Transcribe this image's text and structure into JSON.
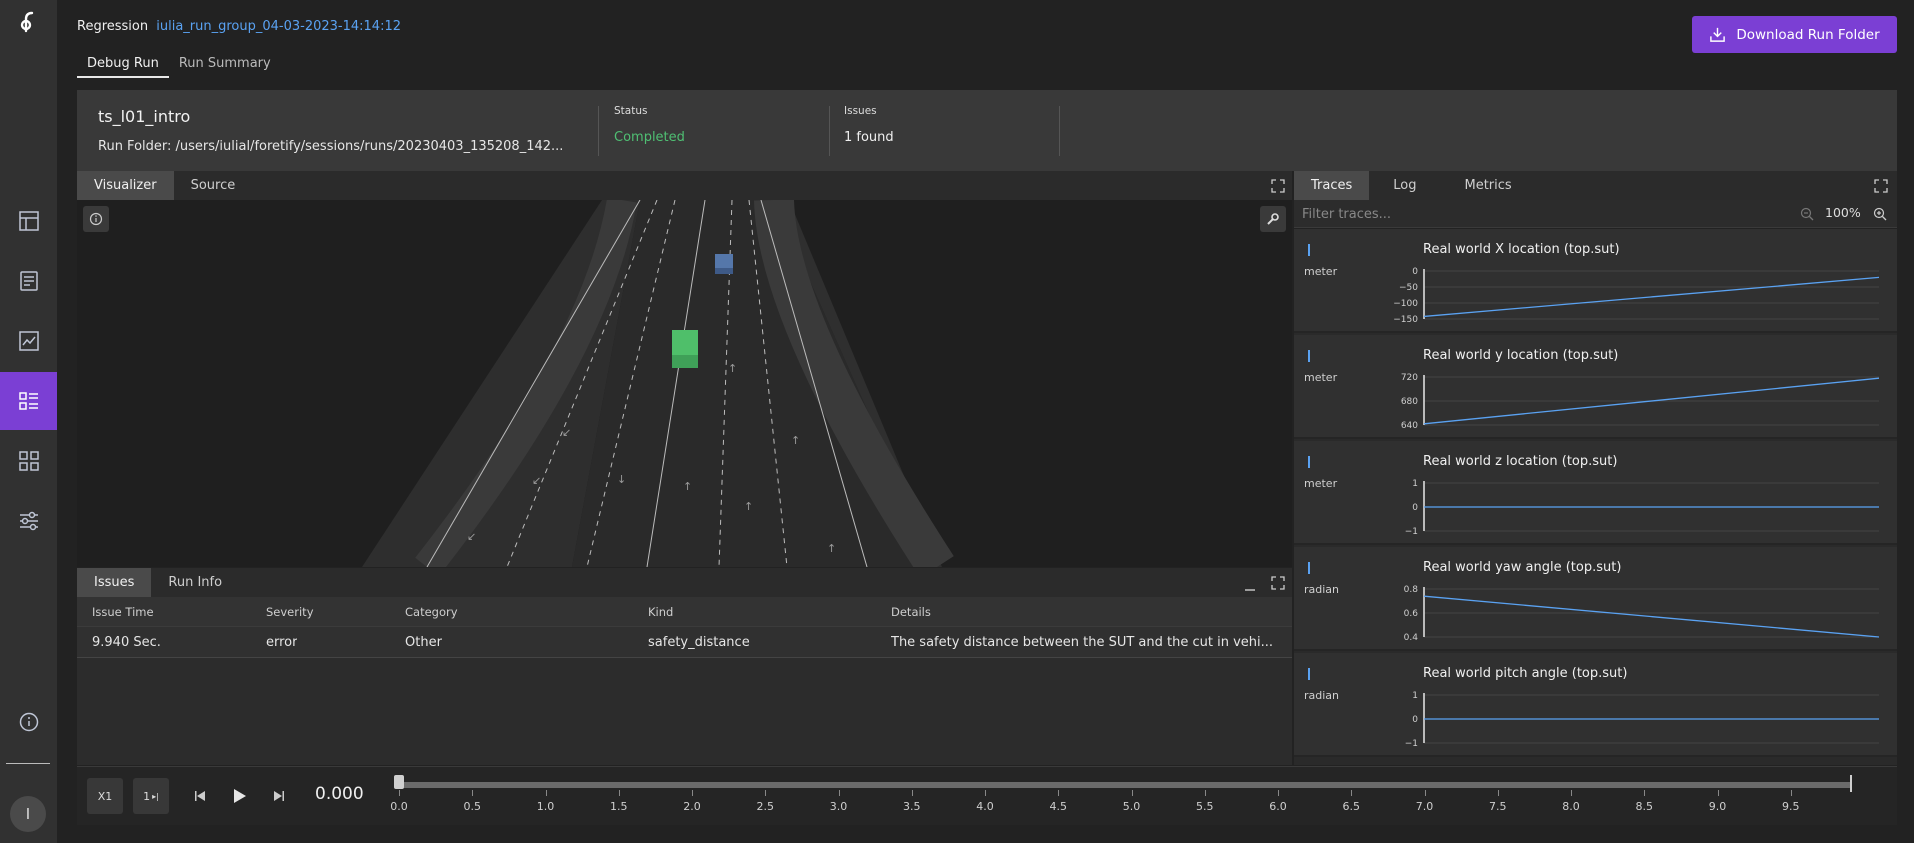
{
  "header": {
    "label": "Regression",
    "run_group": "iulia_run_group_04-03-2023-14:14:12",
    "download_label": "Download Run Folder"
  },
  "top_tabs": [
    {
      "label": "Debug Run",
      "active": true
    },
    {
      "label": "Run Summary",
      "active": false
    }
  ],
  "run": {
    "name": "ts_l01_intro",
    "folder": "Run Folder: /users/iulial/foretify/sessions/runs/20230403_135208_142...",
    "status_label": "Status",
    "status_value": "Completed",
    "issues_label": "Issues",
    "issues_value": "1 found"
  },
  "visualizer": {
    "tabs": [
      {
        "label": "Visualizer",
        "active": true
      },
      {
        "label": "Source",
        "active": false
      }
    ]
  },
  "issues_panel": {
    "tabs": [
      {
        "label": "Issues",
        "active": true
      },
      {
        "label": "Run Info",
        "active": false
      }
    ],
    "columns": [
      "Issue Time",
      "Severity",
      "Category",
      "Kind",
      "Details"
    ],
    "rows": [
      [
        "9.940 Sec.",
        "error",
        "Other",
        "safety_distance",
        "The safety distance between the SUT and the cut in vehi..."
      ]
    ]
  },
  "traces_panel": {
    "tabs": [
      {
        "label": "Traces",
        "active": true
      },
      {
        "label": "Log",
        "active": false
      },
      {
        "label": "Metrics",
        "active": false
      }
    ],
    "filter_placeholder": "Filter traces...",
    "zoom": "100%",
    "traces": [
      {
        "title": "Real world X location (top.sut)",
        "unit": "meter",
        "ticks": [
          "0",
          "−50",
          "−100",
          "−150"
        ],
        "ymin": -150,
        "ymax": 0,
        "start": -142,
        "end": -20
      },
      {
        "title": "Real world y location (top.sut)",
        "unit": "meter",
        "ticks": [
          "720",
          "680",
          "640"
        ],
        "ymin": 640,
        "ymax": 720,
        "start": 642,
        "end": 718
      },
      {
        "title": "Real world z location (top.sut)",
        "unit": "meter",
        "ticks": [
          "1",
          "0",
          "−1"
        ],
        "ymin": -1,
        "ymax": 1,
        "start": 0,
        "end": 0
      },
      {
        "title": "Real world yaw angle (top.sut)",
        "unit": "radian",
        "ticks": [
          "0.8",
          "0.6",
          "0.4"
        ],
        "ymin": 0.4,
        "ymax": 0.8,
        "start": 0.74,
        "end": 0.4
      },
      {
        "title": "Real world pitch angle (top.sut)",
        "unit": "radian",
        "ticks": [
          "1",
          "0",
          "−1"
        ],
        "ymin": -1,
        "ymax": 1,
        "start": 0,
        "end": 0
      }
    ]
  },
  "playback": {
    "speed": "X1",
    "step": "1",
    "time": "0.000",
    "ticks": [
      "0.0",
      "0.5",
      "1.0",
      "1.5",
      "2.0",
      "2.5",
      "3.0",
      "3.5",
      "4.0",
      "4.5",
      "5.0",
      "5.5",
      "6.0",
      "6.5",
      "7.0",
      "7.5",
      "8.0",
      "8.5",
      "9.0",
      "9.5"
    ],
    "progress": 0.0
  },
  "user": {
    "initial": "I"
  },
  "colors": {
    "accent": "#7b3fd4",
    "link": "#5aa2f2",
    "status_completed": "#4fbf73",
    "sut_vehicle": "#4fbf6a",
    "other_vehicle": "#5577aa"
  }
}
